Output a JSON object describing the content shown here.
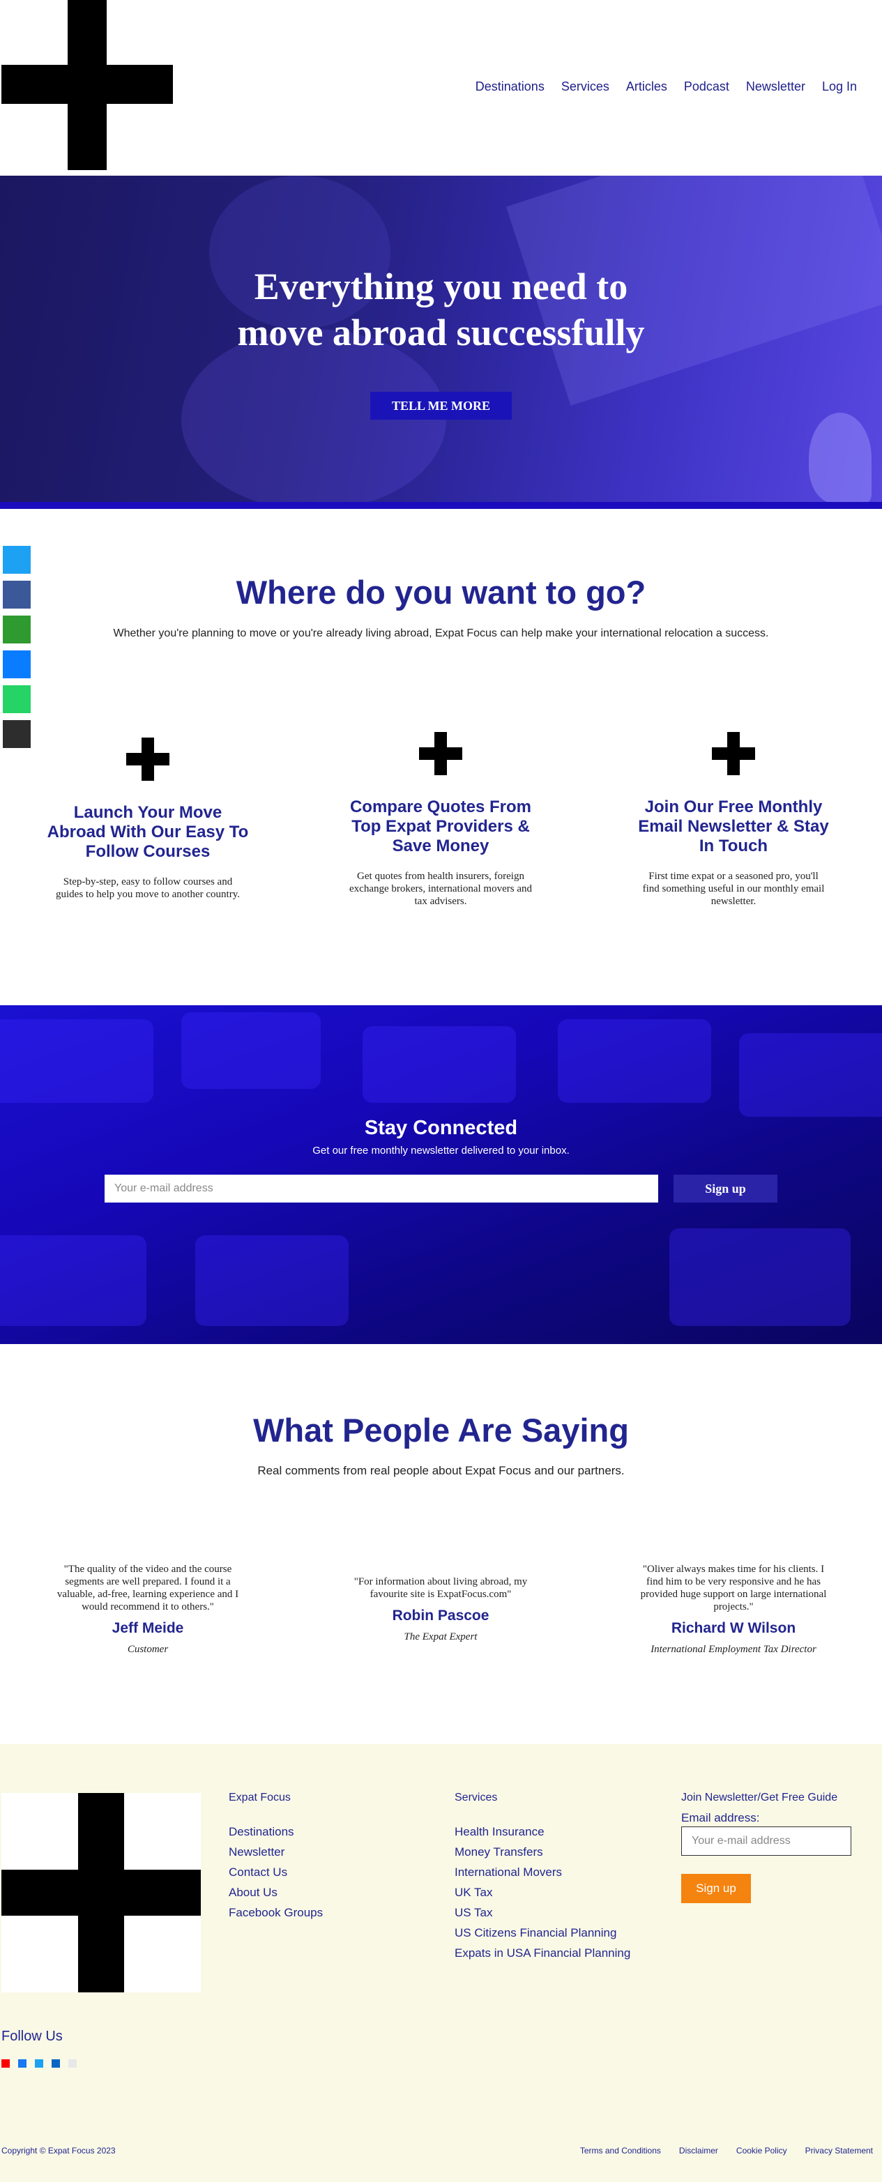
{
  "nav": {
    "items": [
      "Destinations",
      "Services",
      "Articles",
      "Podcast",
      "Newsletter",
      "Log In"
    ],
    "color": "#20218a"
  },
  "hero": {
    "title_line1": "Everything you need to",
    "title_line2": "move abroad successfully",
    "button": "TELL ME MORE"
  },
  "social": {
    "icons": [
      {
        "name": "twitter-icon",
        "color": "#1da1f2"
      },
      {
        "name": "facebook-icon",
        "color": "#3b5998"
      },
      {
        "name": "share-icon",
        "color": "#2f9a2f"
      },
      {
        "name": "messenger-icon",
        "color": "#0a7cff"
      },
      {
        "name": "whatsapp-icon",
        "color": "#25d366"
      },
      {
        "name": "email-icon",
        "color": "#2d2d2d"
      }
    ]
  },
  "where": {
    "title": "Where do you want to go?",
    "subtitle": "Whether you're planning to move or you're already living abroad, Expat Focus can help make your international relocation a success.",
    "features": [
      {
        "title": "Launch Your Move Abroad With Our Easy To Follow Courses",
        "text": "Step-by-step, easy to follow courses and guides to help you move to another country."
      },
      {
        "title": "Compare Quotes From Top Expat Providers & Save Money",
        "text": "Get quotes from health insurers, foreign exchange brokers, international movers and tax advisers."
      },
      {
        "title": "Join Our Free Monthly Email Newsletter & Stay In Touch",
        "text": "First time expat or a seasoned pro, you'll find something useful in our monthly email newsletter."
      }
    ]
  },
  "stay": {
    "title": "Stay Connected",
    "subtitle": "Get our free monthly newsletter delivered to your inbox.",
    "placeholder": "Your e-mail address",
    "button": "Sign up"
  },
  "testimonials": {
    "title": "What People Are Saying",
    "subtitle": "Real comments from real people about Expat Focus and our partners.",
    "items": [
      {
        "quote": "\"The quality of the video and the course segments are well prepared. I found it a valuable, ad-free, learning experience and I would recommend it to others.\"",
        "name": "Jeff Meide",
        "role": "Customer"
      },
      {
        "quote": "\"For information about living abroad, my favourite site is ExpatFocus.com\"",
        "name": "Robin Pascoe",
        "role": "The Expat Expert"
      },
      {
        "quote": "\"Oliver always makes time for his clients. I find him to be very responsive and he has provided huge support on large international projects.\"",
        "name": "Richard W Wilson",
        "role": "International Employment Tax Director"
      }
    ]
  },
  "footer": {
    "col1": {
      "head": "Expat Focus",
      "links": [
        "Destinations",
        "Newsletter",
        "Contact Us",
        "About Us",
        "Facebook Groups"
      ]
    },
    "col2": {
      "head": "Services",
      "links": [
        "Health Insurance",
        "Money Transfers",
        "International Movers",
        "UK Tax",
        "US Tax",
        "US Citizens Financial Planning",
        "Expats in USA Financial Planning"
      ]
    },
    "news": {
      "head": "Join Newsletter/Get Free Guide",
      "label": "Email address:",
      "placeholder": "Your e-mail address",
      "button": "Sign up"
    },
    "follow": "Follow Us",
    "follow_icons": [
      {
        "name": "youtube-icon",
        "color": "#ff0000"
      },
      {
        "name": "facebook-icon",
        "color": "#1877f2"
      },
      {
        "name": "twitter-icon",
        "color": "#1da1f2"
      },
      {
        "name": "linkedin-icon",
        "color": "#0a66c2"
      },
      {
        "name": "instagram-icon",
        "color": "#e8e8e8"
      }
    ],
    "copyright": "Copyright © Expat Focus 2023",
    "legal": [
      "Terms and Conditions",
      "Disclaimer",
      "Cookie Policy",
      "Privacy Statement"
    ]
  }
}
